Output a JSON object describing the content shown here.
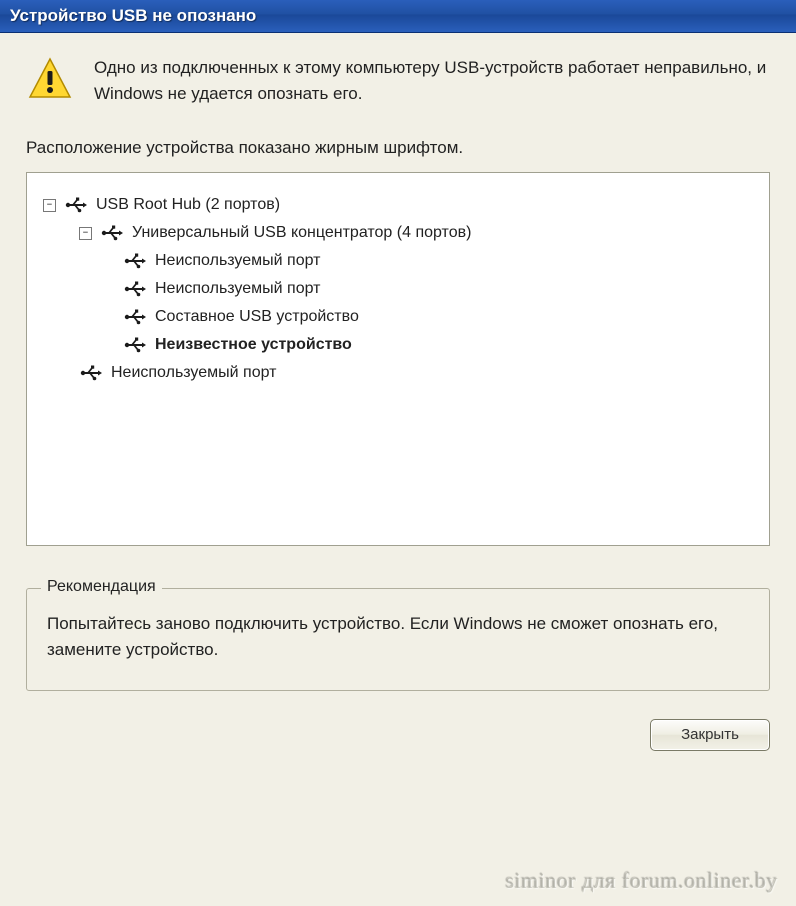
{
  "window": {
    "title": "Устройство USB не опознано"
  },
  "info": "Одно из подключенных к этому компьютеру USB-устройств работает неправильно, и Windows не удается опознать его.",
  "hint": "Расположение устройства показано жирным шрифтом.",
  "tree": {
    "exp_minus": "−",
    "root": {
      "label": "USB Root Hub (2 портов)"
    },
    "hub": {
      "label": "Универсальный USB концентратор (4 портов)"
    },
    "leaf1": "Неиспользуемый порт",
    "leaf2": "Неиспользуемый порт",
    "leaf3": "Составное USB устройство",
    "leaf4": "Неизвестное устройство",
    "leaf5": "Неиспользуемый порт"
  },
  "fieldset": {
    "legend": "Рекомендация",
    "text": "Попытайтесь заново подключить устройство. Если Windows не сможет опознать его, замените устройство."
  },
  "buttons": {
    "close": "Закрыть"
  },
  "watermark": "siminor для forum.onliner.by"
}
